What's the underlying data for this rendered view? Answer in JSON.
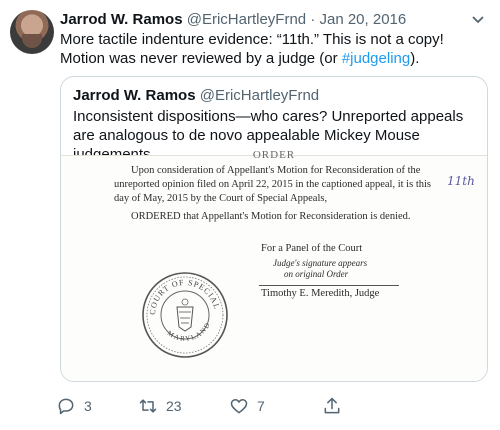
{
  "tweet": {
    "author_name": "Jarrod W. Ramos",
    "author_handle": "@EricHartleyFrnd",
    "separator": "·",
    "date": "Jan 20, 2016",
    "text_before": "More tactile indenture evidence: “11th.” This is not a copy! Motion was never reviewed by a judge (or ",
    "hashtag": "#judgeling",
    "text_after": ")."
  },
  "quoted": {
    "author_name": "Jarrod W. Ramos",
    "author_handle": "@EricHartleyFrnd",
    "text": "Inconsistent dispositions—who cares? Unreported appeals are analogous to de novo appealable Mickey Mouse judgements."
  },
  "document": {
    "header": "ORDER",
    "line1": "Upon consideration of Appellant's Motion for Reconsideration of the",
    "line2": "unreported opinion filed on April 22, 2015 in the captioned appeal, it is this",
    "line3": "day of May,  2015 by the Court of Special Appeals,",
    "line4": "ORDERED that Appellant's Motion for Reconsideration is denied.",
    "handwritten": "11th",
    "panel": "For a Panel of the Court",
    "sig_note1": "Judge's signature appears",
    "sig_note2": "on original Order",
    "judge": "Timothy E. Meredith,  Judge",
    "seal_top": "COURT OF SPECIAL APPEALS",
    "seal_bottom": "MARYLAND"
  },
  "actions": {
    "reply_count": "3",
    "retweet_count": "23",
    "like_count": "7",
    "icons": [
      "reply-icon",
      "retweet-icon",
      "like-icon",
      "share-icon"
    ]
  },
  "colors": {
    "link": "#1d9bf0",
    "muted": "#536471",
    "border": "#cfd9de"
  }
}
